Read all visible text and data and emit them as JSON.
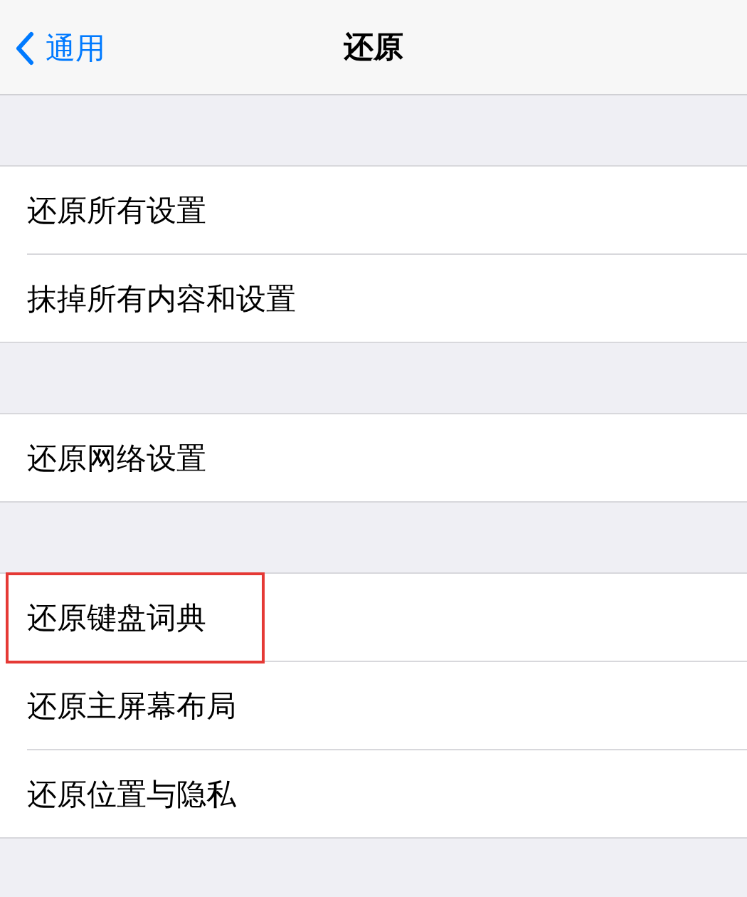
{
  "nav_bar": {
    "back_label": "通用",
    "title": "还原"
  },
  "groups": [
    {
      "items": [
        {
          "label": "还原所有设置",
          "highlighted": false
        },
        {
          "label": "抹掉所有内容和设置",
          "highlighted": false
        }
      ]
    },
    {
      "items": [
        {
          "label": "还原网络设置",
          "highlighted": false
        }
      ]
    },
    {
      "items": [
        {
          "label": "还原键盘词典",
          "highlighted": true
        },
        {
          "label": "还原主屏幕布局",
          "highlighted": false
        },
        {
          "label": "还原位置与隐私",
          "highlighted": false
        }
      ]
    }
  ]
}
